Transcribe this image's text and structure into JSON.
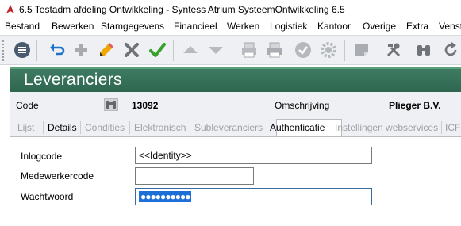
{
  "window": {
    "title": "6.5 Testadm afdeling Ontwikkeling - Syntess Atrium SysteemOntwikkeling 6.5"
  },
  "menu": [
    "Bestand",
    "Bewerken",
    "Stamgegevens",
    "Financieel",
    "Werken",
    "Logistiek",
    "Kantoor",
    "Overige",
    "Extra",
    "Venst"
  ],
  "toolbar": {
    "icons": [
      "menu-icon",
      "undo-icon",
      "add-icon",
      "edit-icon",
      "delete-icon",
      "confirm-icon",
      "arrow-up-icon",
      "arrow-down-icon",
      "print-preview-icon",
      "print-icon",
      "check-circle-icon",
      "gear-icon",
      "note-icon",
      "tools-icon",
      "binoculars-icon",
      "refresh-icon"
    ]
  },
  "page": {
    "title": "Leveranciers"
  },
  "header": {
    "code_label": "Code",
    "code_value": "13092",
    "desc_label": "Omschrijving",
    "desc_value": "Plieger B.V."
  },
  "tabs": [
    "Lijst",
    "Details",
    "Condities",
    "Elektronisch",
    "Subleveranciers",
    "Authenticatie",
    "Instellingen webservices",
    "ICF-"
  ],
  "active_tab": "Authenticatie",
  "form": {
    "login_label": "Inlogcode",
    "login_value": "<<Identity>>",
    "employee_label": "Medewerkercode",
    "employee_value": "",
    "password_label": "Wachtwoord",
    "password_value": "●●●●●●●●●●"
  },
  "colors": {
    "banner": "#2f6650",
    "accent": "#58a27c",
    "selection": "#1f6fd8"
  }
}
